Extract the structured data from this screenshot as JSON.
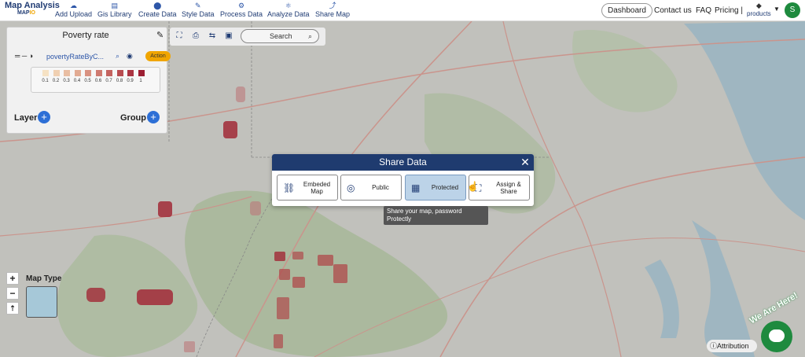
{
  "navbar": {
    "logo_title": "Map Analysis",
    "logo_sub_a": "MAP",
    "logo_sub_b": "IO",
    "items": [
      {
        "label": "Add Upload",
        "icon": "cloud-upload-icon"
      },
      {
        "label": "Gis Library",
        "icon": "library-icon"
      },
      {
        "label": "Create Data",
        "icon": "location-pin-icon"
      },
      {
        "label": "Style Data",
        "icon": "style-icon"
      },
      {
        "label": "Process Data",
        "icon": "process-icon"
      },
      {
        "label": "Analyze Data",
        "icon": "analyze-icon"
      },
      {
        "label": "Share Map",
        "icon": "share-icon"
      }
    ],
    "dashboard": "Dashboard",
    "contact": "Contact us",
    "faq": "FAQ",
    "pricing": "Pricing |",
    "products": "products",
    "avatar_letter": "S"
  },
  "layer_panel": {
    "title": "Poverty rate",
    "layer_name": "povertyRateByC...",
    "action_label": "Action",
    "legend_labels": [
      "0.1",
      "0.2",
      "0.3",
      "0.4",
      "0.5",
      "0.6",
      "0.7",
      "0.8",
      "0.9",
      "1"
    ],
    "legend_colors": [
      "#f6e2c4",
      "#f0d0b2",
      "#e9bea3",
      "#e2ab93",
      "#d99281",
      "#cf7a70",
      "#c4635f",
      "#b84c50",
      "#ab3542",
      "#9c1f33"
    ],
    "layer_label": "Layer",
    "group_label": "Group"
  },
  "toolbar": {
    "search_placeholder": "Search"
  },
  "map_controls": {
    "zoom_in": "+",
    "zoom_out": "−",
    "compass": "⇡",
    "map_type_label": "Map Type"
  },
  "share_modal": {
    "title": "Share Data",
    "close": "✕",
    "options": [
      {
        "label": "Embeded Map",
        "icon": "embed-icon"
      },
      {
        "label": "Public",
        "icon": "globe-icon"
      },
      {
        "label": "Protected",
        "icon": "lock-icon"
      },
      {
        "label": "Assign & Share",
        "icon": "assign-icon"
      }
    ],
    "tooltip": "Share your map, password Protectly"
  },
  "footer": {
    "attribution": "Attribution",
    "we_are_here": "We Are Here!"
  },
  "colors": {
    "navy": "#1f3b6f",
    "accent_orange": "#f0a500",
    "brand_green": "#1e8a3e",
    "plus_blue": "#2d6fd6"
  }
}
